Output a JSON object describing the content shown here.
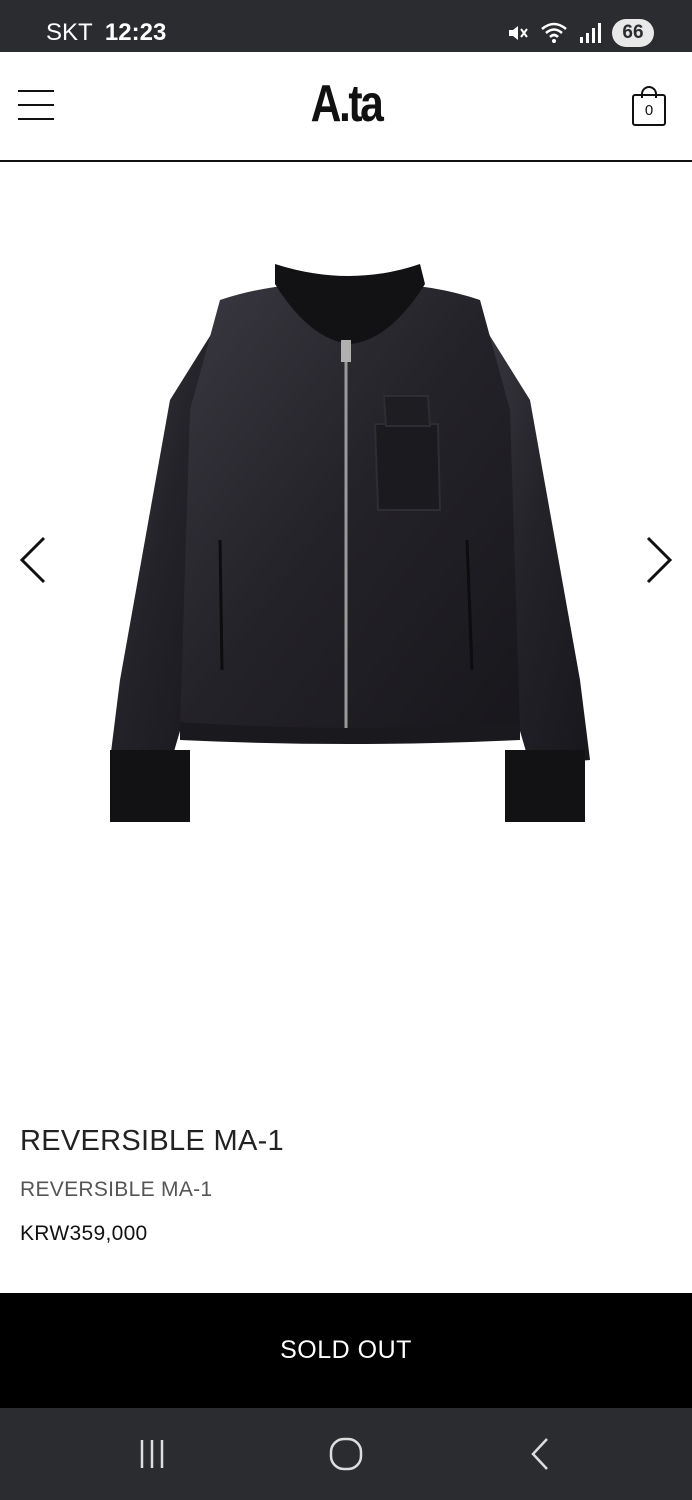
{
  "status_bar": {
    "carrier": "SKT",
    "time": "12:23",
    "battery": "66",
    "icons": [
      "mute-icon",
      "wifi-icon",
      "signal-icon"
    ]
  },
  "header": {
    "logo": "A.ta",
    "cart_count": "0",
    "icons": [
      "hamburger-menu-icon",
      "shopping-bag-icon"
    ]
  },
  "gallery": {
    "image": "black reversible bomber jacket",
    "icons": [
      "chevron-left-icon",
      "chevron-right-icon"
    ]
  },
  "product": {
    "title": "REVERSIBLE MA-1",
    "subtitle": "REVERSIBLE MA-1",
    "price": "KRW359,000"
  },
  "action": {
    "label": "SOLD OUT"
  },
  "system_nav": {
    "icons": [
      "recent-apps-icon",
      "home-icon",
      "back-icon"
    ]
  },
  "colors": {
    "status_bar_bg": "#2b2c30",
    "header_text": "#111111",
    "button_bg": "#000000",
    "button_text": "#ffffff"
  }
}
